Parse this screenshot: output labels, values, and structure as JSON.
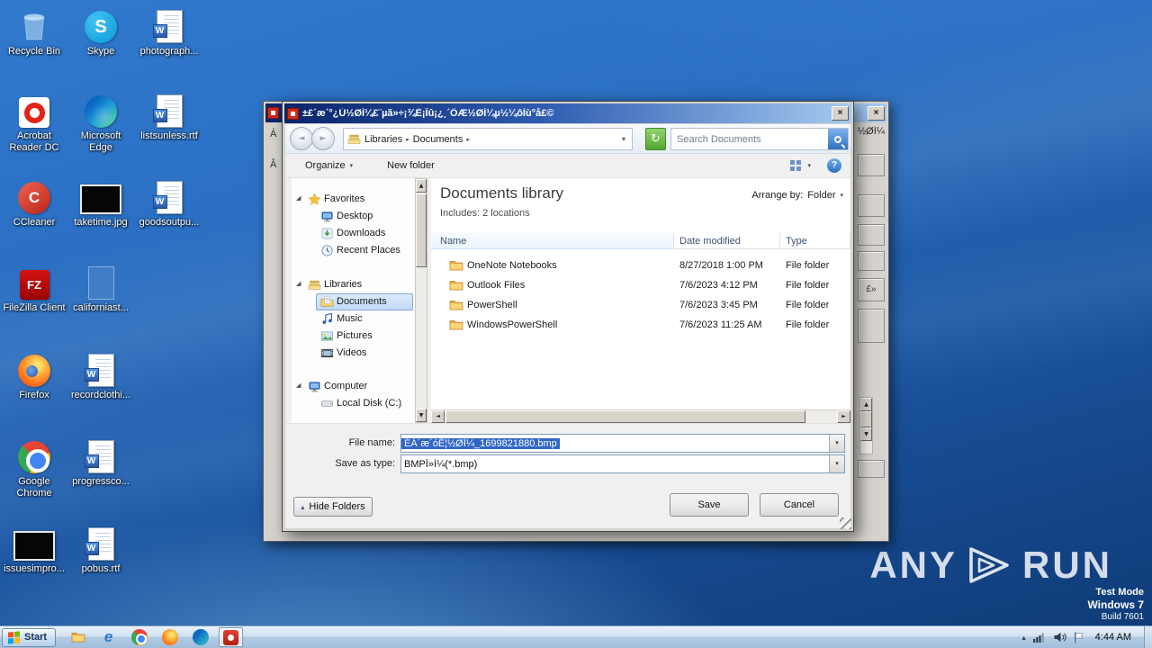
{
  "desktop": {
    "icons": [
      {
        "label": "Recycle Bin",
        "type": "recycle-bin"
      },
      {
        "label": "Skype",
        "type": "skype"
      },
      {
        "label": "photograph...",
        "type": "word-doc"
      },
      {
        "label": "Acrobat Reader DC",
        "type": "acrobat"
      },
      {
        "label": "Microsoft Edge",
        "type": "edge"
      },
      {
        "label": "listsunless.rtf",
        "type": "word-doc"
      },
      {
        "label": "CCleaner",
        "type": "ccleaner"
      },
      {
        "label": "taketime.jpg",
        "type": "image-file"
      },
      {
        "label": "goodsoutpu...",
        "type": "word-doc"
      },
      {
        "label": "FileZilla Client",
        "type": "filezilla"
      },
      {
        "label": "californiast...",
        "type": "ghost-file"
      },
      {
        "label": "Firefox",
        "type": "firefox"
      },
      {
        "label": "recordclothi...",
        "type": "word-doc"
      },
      {
        "label": "Google Chrome",
        "type": "chrome"
      },
      {
        "label": "progressco...",
        "type": "word-doc"
      },
      {
        "label": "issuesimpro...",
        "type": "image-file"
      },
      {
        "label": "pobus.rtf",
        "type": "word-doc"
      }
    ]
  },
  "dialog": {
    "title": "±£´æ´°¿Ú½ØÍ¼£¨µã»÷¡¾È¡Ïû¡¿¸´ÖÆ½ØÍ¼µ½¼ôÌù°å£©",
    "nav": {
      "breadcrumb_root": "Libraries",
      "breadcrumb_current": "Documents",
      "search_placeholder": "Search Documents"
    },
    "toolbar": {
      "organize": "Organize",
      "new_folder": "New folder"
    },
    "tree": {
      "favorites": "Favorites",
      "desktop": "Desktop",
      "downloads": "Downloads",
      "recent": "Recent Places",
      "libraries": "Libraries",
      "documents": "Documents",
      "music": "Music",
      "pictures": "Pictures",
      "videos": "Videos",
      "computer": "Computer",
      "disk": "Local Disk (C:)"
    },
    "library": {
      "title": "Documents library",
      "includes": "Includes:  2 locations",
      "arrange_label": "Arrange by:",
      "arrange_value": "Folder"
    },
    "columns": {
      "name": "Name",
      "modified": "Date modified",
      "type": "Type"
    },
    "files": [
      {
        "name": "OneNote Notebooks",
        "modified": "8/27/2018 1:00 PM",
        "type": "File folder"
      },
      {
        "name": "Outlook Files",
        "modified": "7/6/2023 4:12 PM",
        "type": "File folder"
      },
      {
        "name": "PowerShell",
        "modified": "7/6/2023 3:45 PM",
        "type": "File folder"
      },
      {
        "name": "WindowsPowerShell",
        "modified": "7/6/2023 11:25 AM",
        "type": "File folder"
      }
    ],
    "file_name_label": "File name:",
    "file_name_value": "ÉÁ´æ´óÊ¦½ØÍ¼_1699821880.bmp",
    "save_type_label": "Save as type:",
    "save_type_value": "BMPÎ»Í¼(*.bmp)",
    "hide_folders_label": "Hide Folders",
    "save_label": "Save",
    "cancel_label": "Cancel"
  },
  "background_window": {
    "left_labels": [
      "Á",
      "Â"
    ],
    "right_label": "½ØÍ¼",
    "box_label": "£»"
  },
  "taskbar": {
    "start_label": "Start",
    "clock_time": "4:44 AM"
  },
  "watermark": {
    "brand_left": "ANY",
    "brand_right": "RUN",
    "line1": "Test Mode",
    "line2": "Windows 7",
    "line3": "Build 7601"
  },
  "glyphs": {
    "word": "W",
    "skype": "S",
    "ccleaner": "C",
    "filezilla": "FZ",
    "ie": "e",
    "help": "?",
    "close": "×",
    "back": "◄",
    "forward": "►",
    "refresh": "↻",
    "crumb_sep": "▸",
    "dropdown": "▾",
    "expander_open": "◢",
    "scroll_up": "▲",
    "scroll_down": "▼",
    "scroll_left": "◄",
    "scroll_right": "►",
    "hide_chevron": "▴",
    "tray_chevron": "▴"
  },
  "icon_names": [
    "recycle-bin-icon",
    "skype-icon",
    "word-doc-icon",
    "acrobat-icon",
    "edge-icon",
    "ccleaner-icon",
    "image-thumbnail-icon",
    "filezilla-icon",
    "firefox-icon",
    "chrome-icon",
    "search-icon",
    "refresh-icon",
    "help-icon",
    "views-icon",
    "close-icon",
    "folder-icon",
    "star-icon",
    "monitor-icon",
    "download-icon",
    "clock-icon",
    "libraries-icon",
    "music-note-icon",
    "pictures-icon",
    "videos-icon",
    "drive-icon",
    "windows-flag-icon",
    "play-logo-icon",
    "network-icon",
    "volume-icon",
    "flag-icon"
  ]
}
